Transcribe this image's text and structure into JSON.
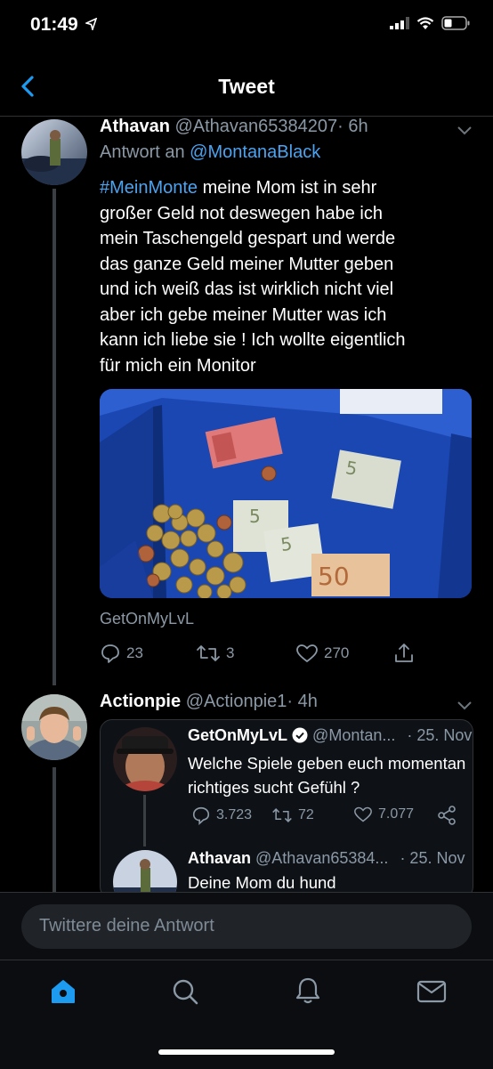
{
  "status_bar": {
    "time": "01:49"
  },
  "nav": {
    "title": "Tweet"
  },
  "tweet": {
    "name": "Athavan",
    "handle": "@Athavan65384207",
    "time": "· 6h",
    "reply_prefix": "Antwort an",
    "reply_to": "@MontanaBlack",
    "hashtag": "#MeinMonte",
    "line1": "meine Mom ist in sehr",
    "lines": [
      "großer Geld not deswegen habe ich",
      "mein Taschengeld gespart und werde",
      "das ganze Geld meiner Mutter geben",
      "und ich weiß das ist wirklich nicht viel",
      "aber ich gebe meiner Mutter was ich",
      "kann ich liebe sie ! Ich wollte eigentlich",
      "für mich ein Monitor"
    ],
    "image_caption": "GetOnMyLvL",
    "replies": "23",
    "retweets": "3",
    "likes": "270"
  },
  "reply": {
    "name": "Actionpie",
    "handle": "@Actionpie1",
    "time": "· 4h",
    "quote": {
      "author1": {
        "name": "GetOnMyLvL",
        "handle": "@Montan...",
        "date": "· 25. Nov",
        "text_lines": [
          "Welche Spiele geben euch momentan",
          "richtiges sucht Gefühl ?"
        ],
        "replies": "3.723",
        "retweets": "72",
        "likes": "7.077"
      },
      "author2": {
        "name": "Athavan",
        "handle": "@Athavan65384...",
        "date": "· 25. Nov",
        "text": "Deine Mom du hund"
      }
    }
  },
  "composer": {
    "placeholder": "Twittere deine Antwort"
  },
  "colors": {
    "accent": "#1d9bf0",
    "link": "#4ca3f0",
    "background": "#000000"
  },
  "tabs": [
    "home-icon",
    "search-icon",
    "notifications-icon",
    "messages-icon"
  ]
}
